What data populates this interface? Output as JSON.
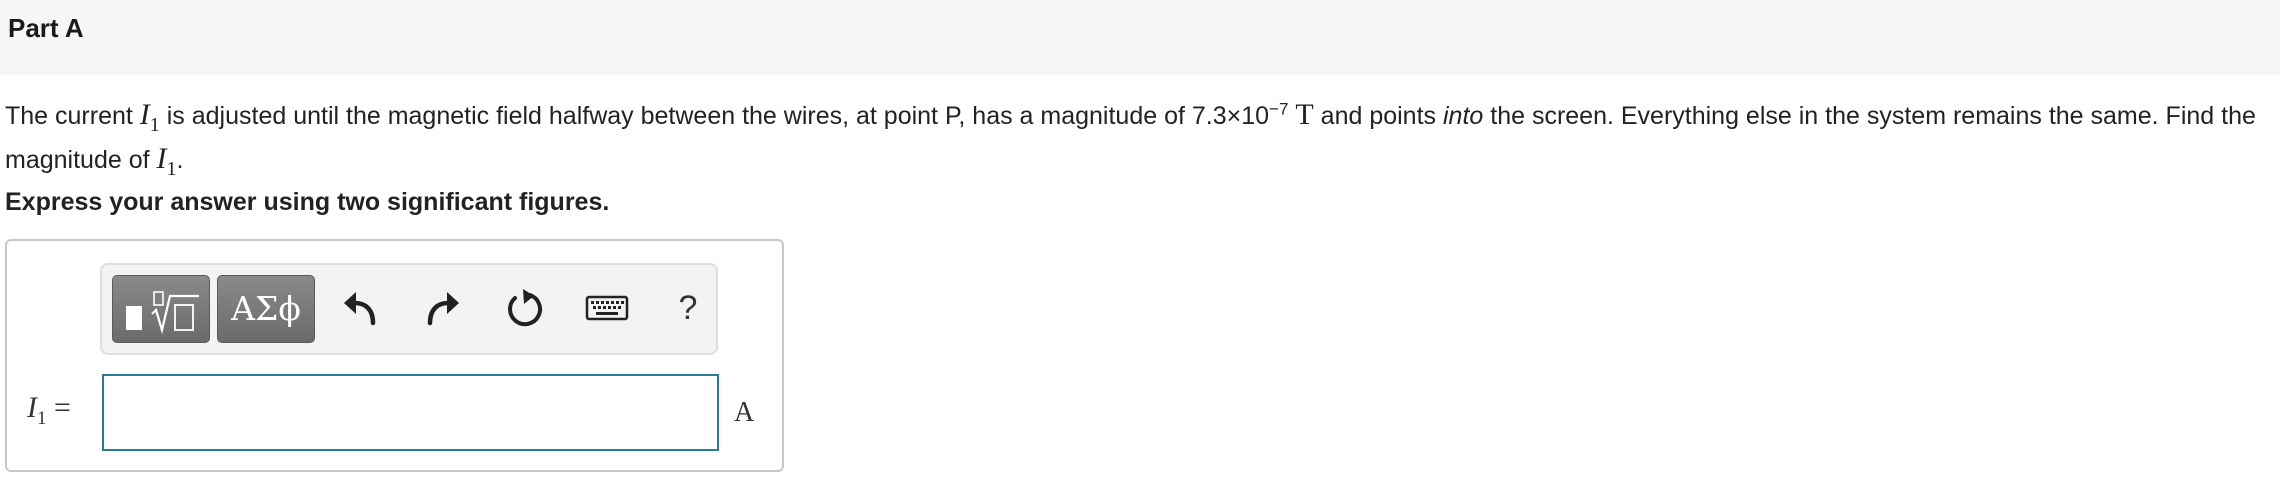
{
  "part": {
    "title": "Part A"
  },
  "question": {
    "text_1": "The current ",
    "var_symbol": "I",
    "var_subscript": "1",
    "text_2": " is adjusted until the magnetic field halfway between the wires, at point P, has a magnitude of 7.3×10",
    "exponent": "−7",
    "unit_symbol": "T",
    "text_3": " and points ",
    "emphasis": "into",
    "text_4": " the screen. Everything else in the system remains the same. Find the magnitude of ",
    "text_5": "."
  },
  "instruction": "Express your answer using two significant figures.",
  "toolbar": {
    "greek_label": "ΑΣϕ",
    "help_label": "?",
    "icons": {
      "template": "templates-icon",
      "undo": "undo-icon",
      "redo": "redo-icon",
      "reset": "reset-icon",
      "keyboard": "keyboard-icon"
    }
  },
  "answer": {
    "variable": "I",
    "variable_subscript": "1",
    "equals": "=",
    "value": "",
    "unit": "A"
  },
  "colors": {
    "header_bg": "#f6f6f6",
    "input_border": "#2b7c93",
    "toolbar_button": "#7a7a7a"
  }
}
